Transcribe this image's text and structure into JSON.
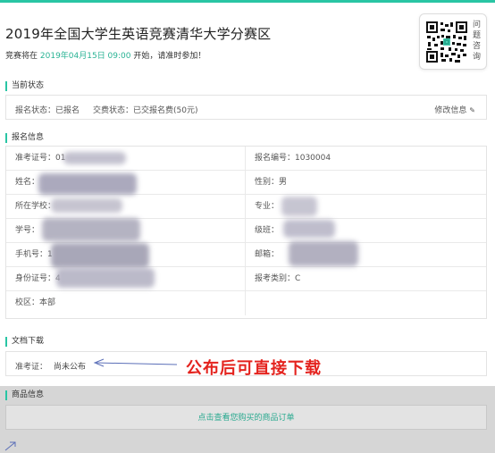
{
  "header": {
    "title": "2019年全国大学生英语竞赛清华大学分赛区",
    "subtitle_prefix": "竞赛将在",
    "subtitle_date": "2019年04月15日 09:00",
    "subtitle_suffix": "开始，请准时参加！"
  },
  "qr": {
    "label": "问题咨询"
  },
  "current_status": {
    "heading": "当前状态",
    "registration": "报名状态：已报名",
    "payment": "交费状态：已交报名费(50元)",
    "edit_label": "修改信息"
  },
  "registration_info": {
    "heading": "报名信息",
    "rows": [
      {
        "left_label": "准考证号：01",
        "right_label": "报名编号：1030004"
      },
      {
        "left_label": "姓名：",
        "right_label": "性别：男"
      },
      {
        "left_label": "所在学校：",
        "right_label": "专业："
      },
      {
        "left_label": "学号：",
        "right_label": "级班："
      },
      {
        "left_label": "手机号：1",
        "right_label": "邮箱："
      },
      {
        "left_label": "身份证号：4",
        "right_label": "报考类别：C"
      },
      {
        "left_label": "校区：本部",
        "right_label": ""
      }
    ]
  },
  "documents": {
    "heading": "文档下载",
    "ticket_label": "准考证：",
    "ticket_value": "尚未公布"
  },
  "annotation": {
    "text": "公布后可直接下载"
  },
  "goods": {
    "heading": "商品信息",
    "link_label": "点击查看您购买的商品订单"
  },
  "colors": {
    "accent": "#29c5a4",
    "annotation": "#e4231e"
  }
}
